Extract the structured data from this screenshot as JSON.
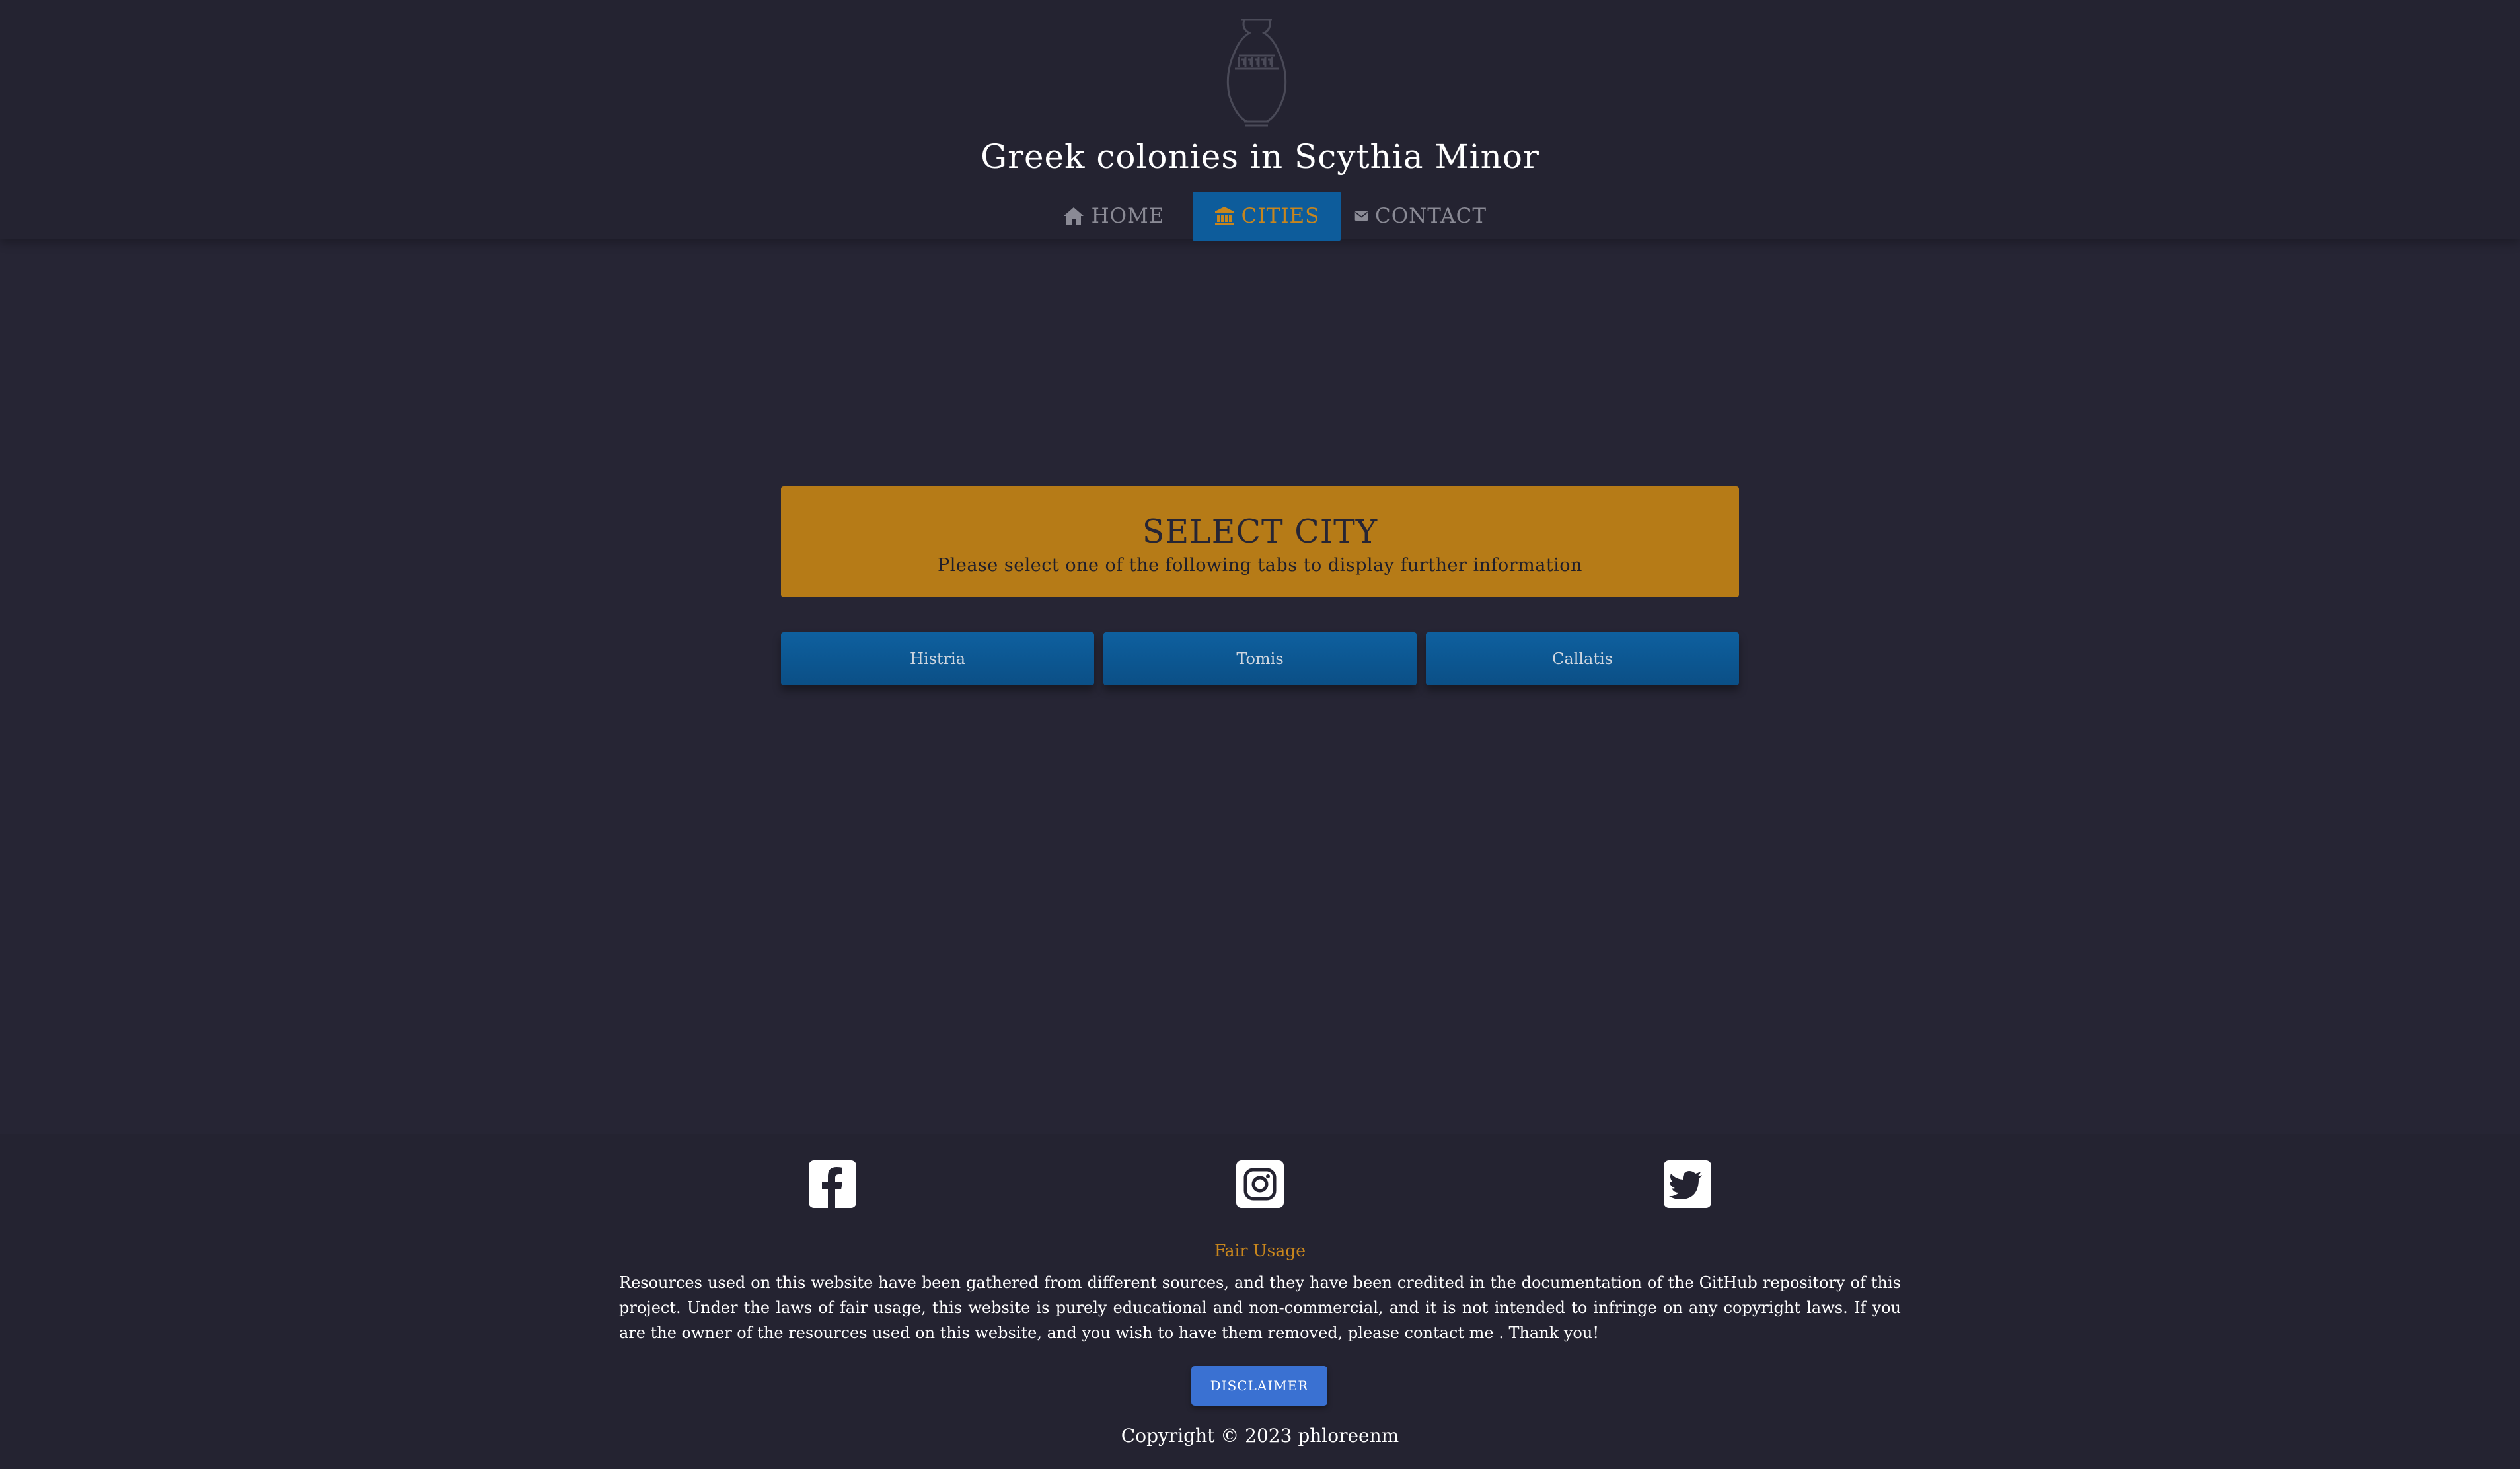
{
  "header": {
    "logo_icon": "greek-vase-icon",
    "site_title": "Greek colonies in Scythia Minor",
    "nav": [
      {
        "label": "HOME",
        "icon": "home-icon"
      },
      {
        "label": "CITIES",
        "icon": "building-icon",
        "active": true
      },
      {
        "label": "CONTACT",
        "icon": "envelope-icon"
      }
    ]
  },
  "main": {
    "banner": {
      "title": "SELECT CITY",
      "subtitle": "Please select one of the following tabs to display further information"
    },
    "city_tabs": [
      "Histria",
      "Tomis",
      "Callatis"
    ]
  },
  "footer": {
    "social": [
      {
        "icon": "facebook-icon"
      },
      {
        "icon": "instagram-icon"
      },
      {
        "icon": "twitter-icon"
      }
    ],
    "fair_usage_title": "Fair Usage",
    "fair_usage_text": "Resources used on this website have been gathered from different sources, and they have been credited in the documentation of the GitHub repository of this project. Under the laws of fair usage, this website is purely educational and non-commercial, and it is not intended to infringe on any copyright laws. If you are the owner of the resources used on this website, and you wish to have them removed, please contact me . Thank you!",
    "disclaimer_label": "DISCLAIMER",
    "copyright": "Copyright © 2023 phloreenm"
  },
  "colors": {
    "background": "#262534",
    "accent_blue": "#0d5c9b",
    "accent_gold": "#b67b17",
    "nav_active_text": "#c8861d",
    "button_blue": "#3a71d2"
  }
}
